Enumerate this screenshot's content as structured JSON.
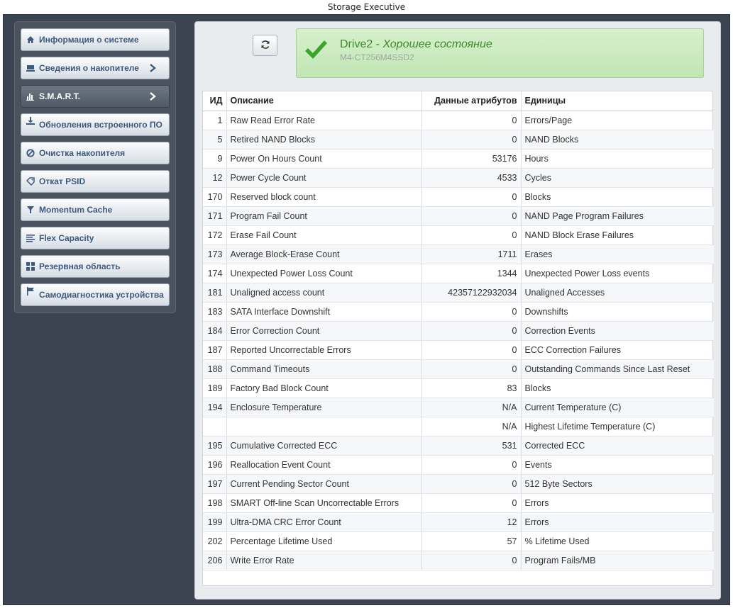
{
  "window": {
    "title": "Storage Executive"
  },
  "sidebar": {
    "items": [
      {
        "label": "Информация о системе",
        "icon": "home-icon"
      },
      {
        "label": "Сведения о накопителе",
        "icon": "drive-icon"
      },
      {
        "label": "S.M.A.R.T.",
        "icon": "bar-chart-icon"
      },
      {
        "label": "Обновления встроенного ПО",
        "icon": "download-icon"
      },
      {
        "label": "Очистка накопителя",
        "icon": "ban-icon"
      },
      {
        "label": "Откат PSID",
        "icon": "tag-icon"
      },
      {
        "label": "Momentum Cache",
        "icon": "filter-icon"
      },
      {
        "label": "Flex Capacity",
        "icon": "list-icon"
      },
      {
        "label": "Резервная область",
        "icon": "grid-icon"
      },
      {
        "label": "Самодиагностика устройства",
        "icon": "flag-icon"
      }
    ],
    "active_index": 2
  },
  "status": {
    "drive": "Drive2",
    "separator": " - ",
    "state": "Хорошее состояние",
    "model": "M4-CT256M4SSD2",
    "color": "#3a8a2e"
  },
  "table": {
    "headers": {
      "id": "ИД",
      "description": "Описание",
      "value": "Данные атрибутов",
      "units": "Единицы"
    },
    "rows": [
      {
        "id": "1",
        "description": "Raw Read Error Rate",
        "value": "0",
        "units": "Errors/Page"
      },
      {
        "id": "5",
        "description": "Retired NAND Blocks",
        "value": "0",
        "units": "NAND Blocks"
      },
      {
        "id": "9",
        "description": "Power On Hours Count",
        "value": "53176",
        "units": "Hours"
      },
      {
        "id": "12",
        "description": "Power Cycle Count",
        "value": "4533",
        "units": "Cycles"
      },
      {
        "id": "170",
        "description": "Reserved block count",
        "value": "0",
        "units": "Blocks"
      },
      {
        "id": "171",
        "description": "Program Fail Count",
        "value": "0",
        "units": "NAND Page Program Failures"
      },
      {
        "id": "172",
        "description": "Erase Fail Count",
        "value": "0",
        "units": "NAND Block Erase Failures"
      },
      {
        "id": "173",
        "description": "Average Block-Erase Count",
        "value": "1711",
        "units": "Erases"
      },
      {
        "id": "174",
        "description": "Unexpected Power Loss Count",
        "value": "1344",
        "units": "Unexpected Power Loss events"
      },
      {
        "id": "181",
        "description": "Unaligned access count",
        "value": "42357122932034",
        "units": "Unaligned Accesses"
      },
      {
        "id": "183",
        "description": "SATA Interface Downshift",
        "value": "0",
        "units": "Downshifts"
      },
      {
        "id": "184",
        "description": "Error Correction Count",
        "value": "0",
        "units": "Correction Events"
      },
      {
        "id": "187",
        "description": "Reported Uncorrectable Errors",
        "value": "0",
        "units": "ECC Correction Failures"
      },
      {
        "id": "188",
        "description": "Command Timeouts",
        "value": "0",
        "units": "Outstanding Commands Since Last Reset"
      },
      {
        "id": "189",
        "description": "Factory Bad Block Count",
        "value": "83",
        "units": "Blocks"
      },
      {
        "id": "194",
        "description": "Enclosure Temperature",
        "value": "N/A",
        "units": "Current Temperature (C)"
      },
      {
        "id": "",
        "description": "",
        "value": "N/A",
        "units": "Highest Lifetime Temperature (C)"
      },
      {
        "id": "195",
        "description": "Cumulative Corrected ECC",
        "value": "531",
        "units": "Corrected ECC"
      },
      {
        "id": "196",
        "description": "Reallocation Event Count",
        "value": "0",
        "units": "Events"
      },
      {
        "id": "197",
        "description": "Current Pending Sector Count",
        "value": "0",
        "units": "512 Byte Sectors"
      },
      {
        "id": "198",
        "description": "SMART Off-line Scan Uncorrectable Errors",
        "value": "0",
        "units": "Errors"
      },
      {
        "id": "199",
        "description": "Ultra-DMA CRC Error Count",
        "value": "12",
        "units": "Errors"
      },
      {
        "id": "202",
        "description": "Percentage Lifetime Used",
        "value": "57",
        "units": "% Lifetime Used"
      },
      {
        "id": "206",
        "description": "Write Error Rate",
        "value": "0",
        "units": "Program Fails/MB"
      }
    ]
  }
}
